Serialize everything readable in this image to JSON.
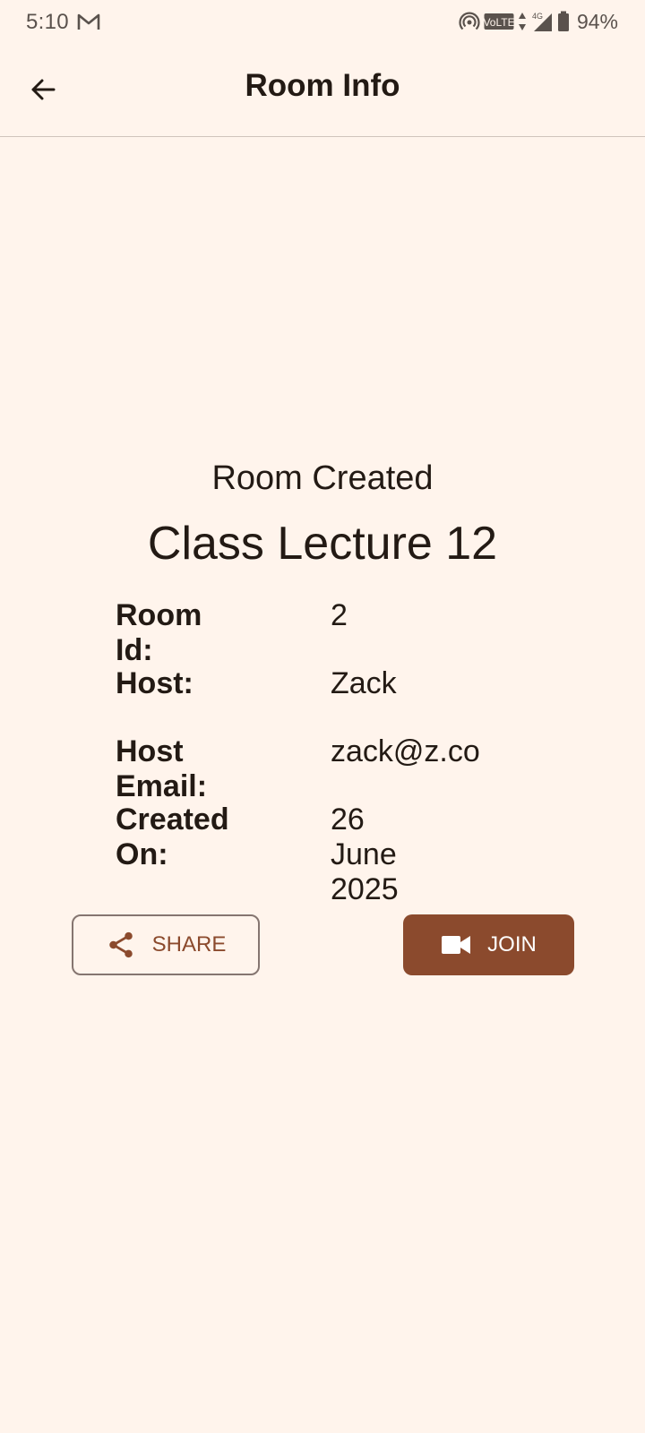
{
  "status_bar": {
    "time": "5:10",
    "battery": "94%",
    "icons": [
      "gmail-icon",
      "hotspot-icon",
      "volte-icon",
      "data-arrows-icon",
      "signal-4g-icon",
      "battery-icon"
    ],
    "volte_text": "VoLTE",
    "network_text": "4G"
  },
  "app_bar": {
    "back_icon": "arrow-back-icon",
    "title": "Room Info"
  },
  "room": {
    "status": "Room Created",
    "name": "Class Lecture 12",
    "details": [
      {
        "label": "Room Id:",
        "value": "2"
      },
      {
        "label": "Host:",
        "value": "Zack"
      },
      {
        "label": "Host Email:",
        "value": "zack@z.co"
      },
      {
        "label": "Created On:",
        "value": "26 June 2025"
      }
    ]
  },
  "actions": {
    "share_label": "SHARE",
    "share_icon": "share-icon",
    "join_label": "JOIN",
    "join_icon": "videocam-icon"
  },
  "colors": {
    "background": "#FFF4EC",
    "primary": "#8B4A2D",
    "text": "#231A14",
    "outline": "#857570"
  }
}
